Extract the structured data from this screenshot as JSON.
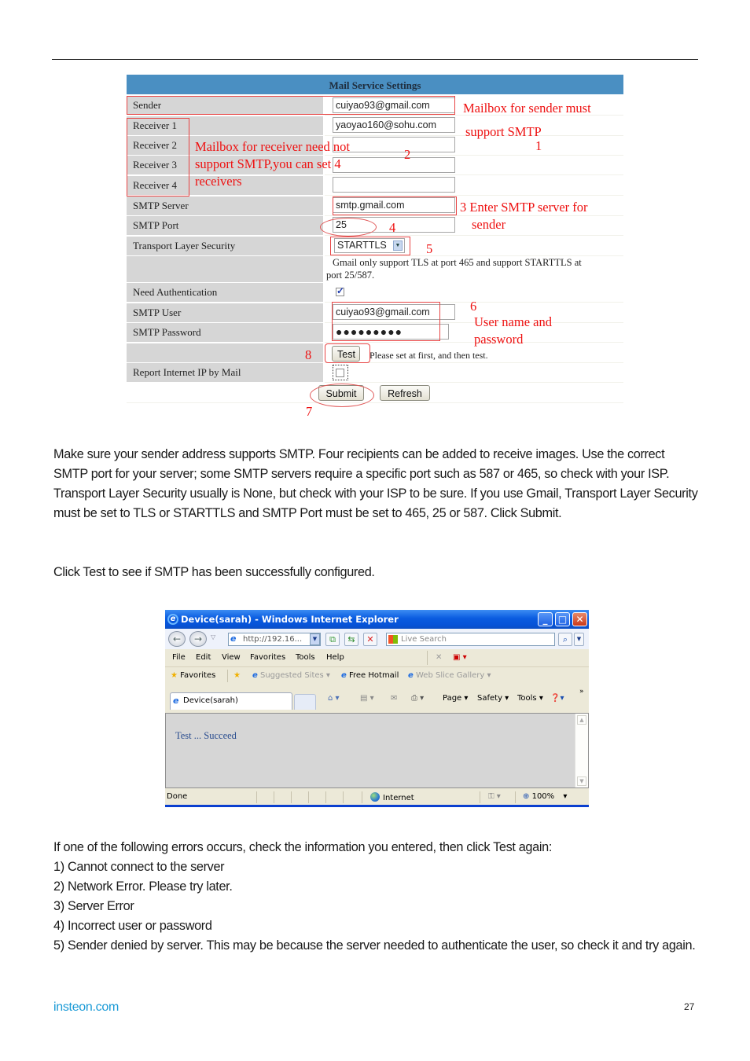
{
  "mail_settings": {
    "title": "Mail Service Settings",
    "rows": [
      {
        "label": "Sender",
        "value": "cuiyao93@gmail.com"
      },
      {
        "label": "Receiver 1",
        "value": "yaoyao160@sohu.com"
      },
      {
        "label": "Receiver 2",
        "value": ""
      },
      {
        "label": "Receiver 3",
        "value": ""
      },
      {
        "label": "Receiver 4",
        "value": ""
      },
      {
        "label": "SMTP Server",
        "value": "smtp.gmail.com"
      },
      {
        "label": "SMTP Port",
        "value": "25"
      },
      {
        "label": "Transport Layer Security",
        "value": "STARTTLS"
      },
      {
        "label": "Need Authentication",
        "checked": true
      },
      {
        "label": "SMTP User",
        "value": "cuiyao93@gmail.com"
      },
      {
        "label": "SMTP Password",
        "value": "●●●●●●●●●"
      },
      {
        "label": "Report Internet IP by Mail",
        "checked": false
      }
    ],
    "tls_note_line1": "Gmail only support TLS at port 465 and support STARTTLS at",
    "tls_note_line2": "port 25/587.",
    "test_button": "Test",
    "test_hint": "Please set at first, and then test.",
    "submit_button": "Submit",
    "refresh_button": "Refresh",
    "annotations": {
      "a1_line1": "Mailbox for sender must",
      "a1_line2": "support SMTP",
      "a1_num": "1",
      "a2_line1": "Mailbox for receiver need not",
      "a2_line2": "support SMTP,you can set 4",
      "a2_line3": "receivers",
      "a2_num": "2",
      "a3_line1": "3 Enter SMTP server for",
      "a3_line2": "sender",
      "a4_num": "4",
      "a5_num": "5",
      "a6_num": "6",
      "a6_line1": "User name and",
      "a6_line2": "password",
      "a7_num": "7",
      "a8_num": "8"
    }
  },
  "paragraphs": {
    "p1": "Make sure your sender address supports SMTP. Four recipients can be added to receive images. Use the correct SMTP port for your server; some SMTP servers require a specific port such as 587 or 465, so check with your ISP. Transport Layer Security usually is None, but check with your ISP to be sure. If you use Gmail, Transport Layer Security must be set to TLS or STARTTLS and SMTP Port must be set to 465, 25 or 587. Click Submit.",
    "p2": "Click Test to see if SMTP has been successfully configured.",
    "p3_intro": "If one of the following errors occurs, check the information you entered, then click Test again:",
    "errors": [
      "1) Cannot connect to the server",
      "2) Network Error. Please try later.",
      "3) Server Error",
      "4) Incorrect user or password",
      "5) Sender denied by server. This may be because the server needed to authenticate the user, so check it and try again."
    ]
  },
  "browser": {
    "title": "Device(sarah) - Windows Internet Explorer",
    "address": "http://192.16...",
    "search_placeholder": "Live Search",
    "menu": [
      "File",
      "Edit",
      "View",
      "Favorites",
      "Tools",
      "Help"
    ],
    "favorites_label": "Favorites",
    "suggested_sites": "Suggested Sites ▾",
    "free_hotmail": "Free Hotmail",
    "web_slice_gallery": "Web Slice Gallery ▾",
    "tab_label": "Device(sarah)",
    "cmd_page": "Page ▾",
    "cmd_safety": "Safety ▾",
    "cmd_tools": "Tools ▾",
    "content_message": "Test  ...  Succeed",
    "status_done": "Done",
    "status_zone": "Internet",
    "zoom_level": "100%"
  },
  "footer": {
    "site": "insteon.com",
    "page_number": "27"
  }
}
